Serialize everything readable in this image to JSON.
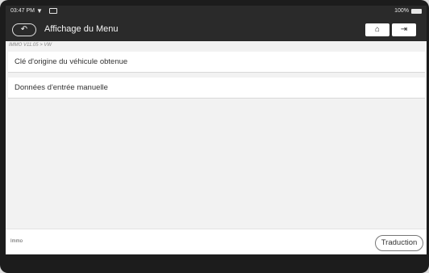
{
  "status_bar": {
    "time": "03:47 PM",
    "battery_pct": "100%",
    "wifi_icon": "wifi-icon",
    "sd_icon": "sd-card-icon",
    "battery_icon": "battery-icon"
  },
  "header": {
    "back_icon": "back-arrow-icon",
    "title": "Affichage du Menu",
    "home_icon": "home-icon",
    "exit_icon": "exit-icon"
  },
  "breadcrumb": "IMMO V11.05 > VW",
  "menu": {
    "items": [
      {
        "label": "Clé d'origine du véhicule obtenue"
      },
      {
        "label": "Données d'entrée manuelle"
      }
    ]
  },
  "footer": {
    "label": "Immo",
    "translate_label": "Traduction"
  }
}
